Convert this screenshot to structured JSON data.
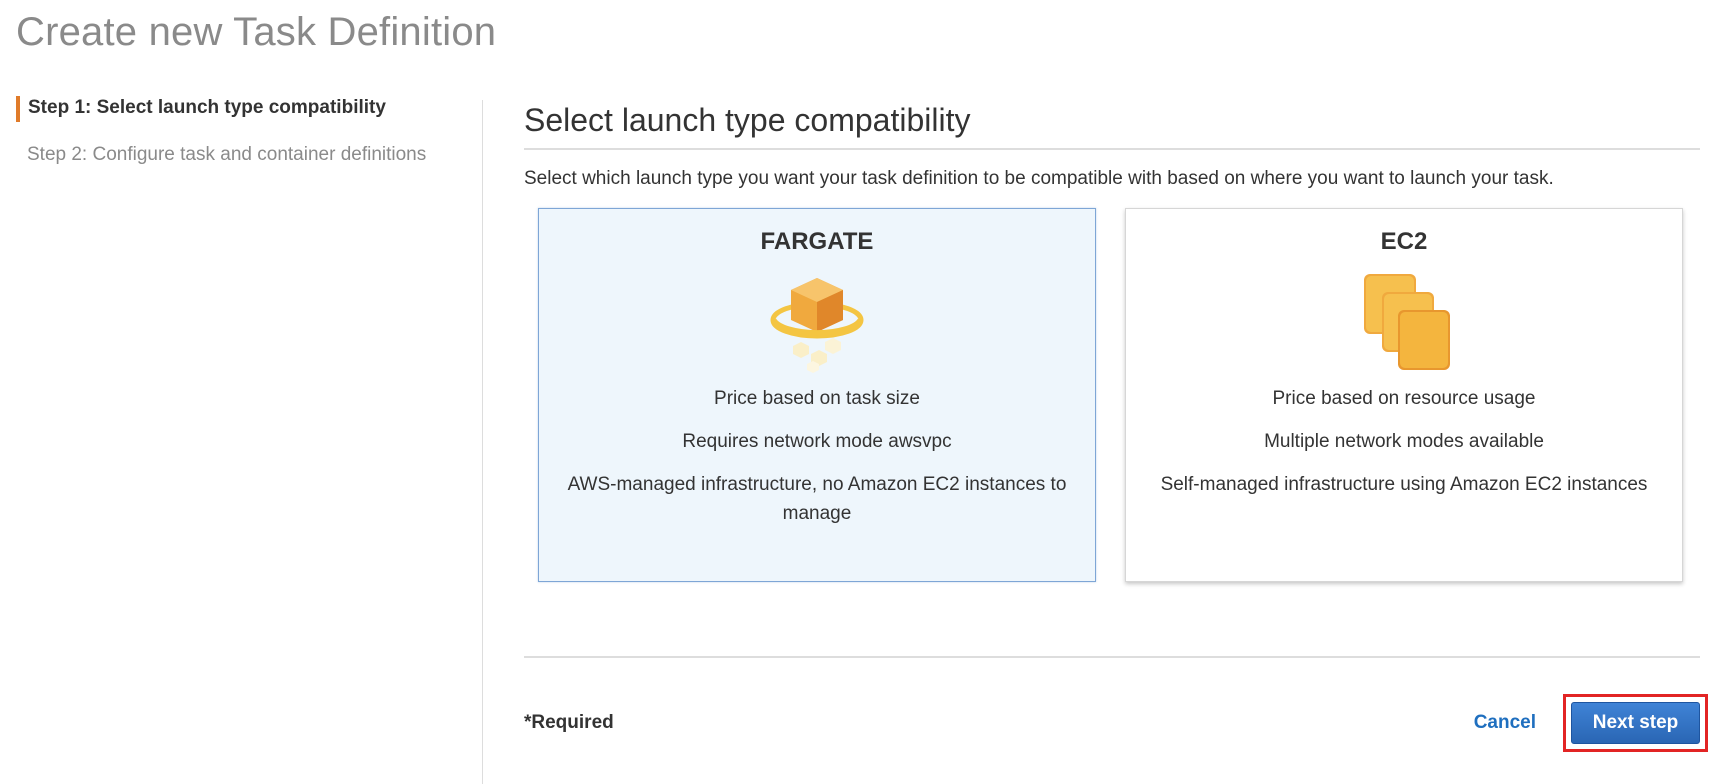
{
  "page": {
    "title": "Create new Task Definition"
  },
  "steps": [
    {
      "label": "Step 1: Select launch type compatibility",
      "active": true
    },
    {
      "label": "Step 2: Configure task and container definitions",
      "active": false
    }
  ],
  "section": {
    "title": "Select launch type compatibility",
    "description": "Select which launch type you want your task definition to be compatible with based on where you want to launch your task."
  },
  "launch_types": [
    {
      "title": "FARGATE",
      "icon": "fargate-cube-icon",
      "selected": true,
      "lines": [
        "Price based on task size",
        "Requires network mode awsvpc",
        "AWS-managed infrastructure, no Amazon EC2 instances to manage"
      ]
    },
    {
      "title": "EC2",
      "icon": "ec2-instances-icon",
      "selected": false,
      "lines": [
        "Price based on resource usage",
        "Multiple network modes available",
        "Self-managed infrastructure using Amazon EC2 instances"
      ]
    }
  ],
  "footer": {
    "required_label": "*Required",
    "cancel_label": "Cancel",
    "next_label": "Next step"
  },
  "colors": {
    "accent_orange": "#e07b2a",
    "link_blue": "#1f6fbf",
    "primary_button": "#2d6fc4",
    "selected_card_bg": "#eef6fc",
    "highlight_red": "#e22424"
  }
}
